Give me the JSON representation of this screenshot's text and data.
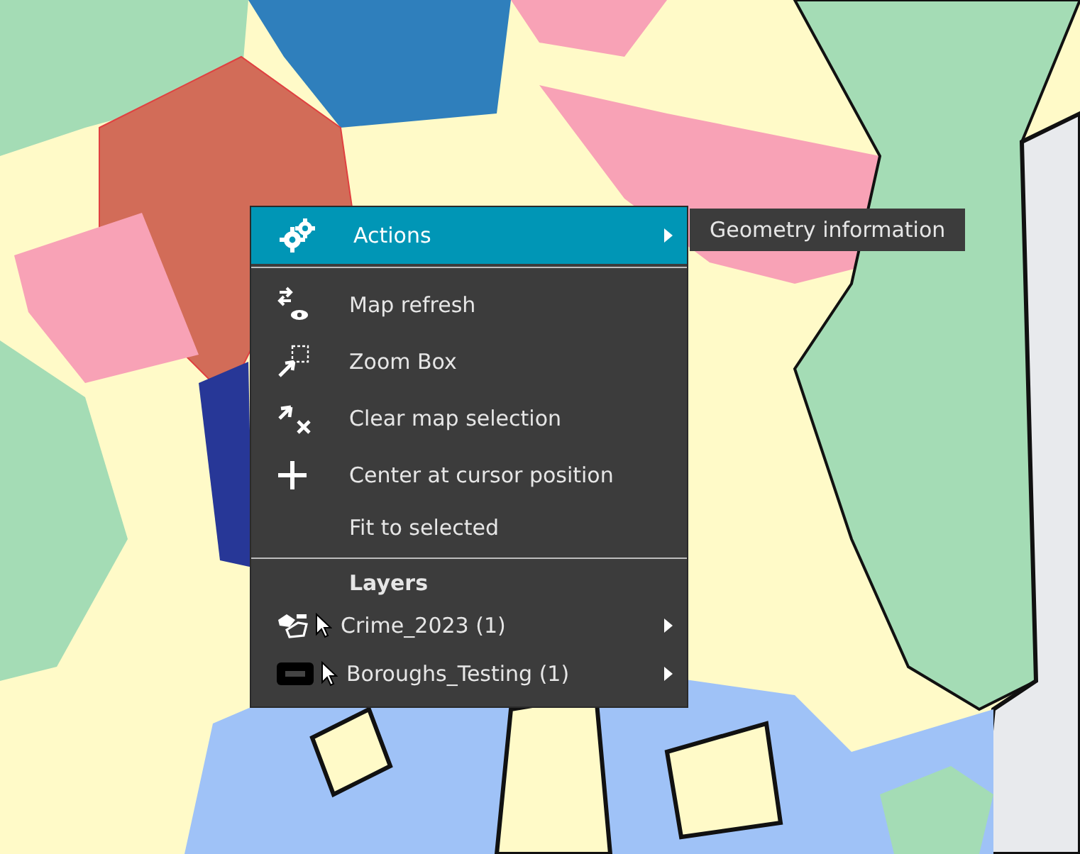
{
  "context_menu": {
    "actions": {
      "label": "Actions",
      "selected": true,
      "has_submenu": true
    },
    "items": [
      {
        "label": "Map refresh",
        "kind": "refresh"
      },
      {
        "label": "Zoom Box",
        "kind": "zoom-box"
      },
      {
        "label": "Clear map selection",
        "kind": "clear"
      },
      {
        "label": "Center at cursor position",
        "kind": "center"
      },
      {
        "label": "Fit to selected",
        "kind": "plain"
      }
    ],
    "layers_header": "Layers",
    "layers": [
      {
        "label": "Crime_2023 (1)",
        "kind": "polygons",
        "has_submenu": true
      },
      {
        "label": "Boroughs_Testing (1)",
        "kind": "rectangle",
        "has_submenu": true
      }
    ]
  },
  "submenu": {
    "items": [
      "Geometry information"
    ]
  }
}
